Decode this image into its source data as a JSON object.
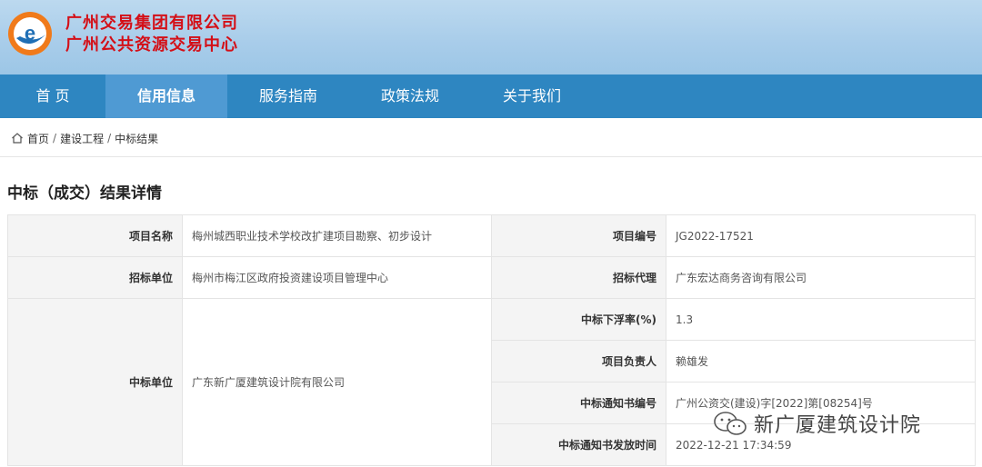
{
  "org": {
    "name_line1": "广州交易集团有限公司",
    "name_line2": "广州公共资源交易中心"
  },
  "nav": {
    "items": [
      {
        "label": "首 页"
      },
      {
        "label": "信用信息"
      },
      {
        "label": "服务指南"
      },
      {
        "label": "政策法规"
      },
      {
        "label": "关于我们"
      }
    ]
  },
  "breadcrumb": {
    "home": "首页",
    "level2": "建设工程",
    "level3": "中标结果",
    "separator": "/"
  },
  "page": {
    "title": "中标（成交）结果详情"
  },
  "detail": {
    "project_name": {
      "label": "项目名称",
      "value": "梅州城西职业技术学校改扩建项目勘察、初步设计"
    },
    "project_no": {
      "label": "项目编号",
      "value": "JG2022-17521"
    },
    "tenderer": {
      "label": "招标单位",
      "value": "梅州市梅江区政府投资建设项目管理中心"
    },
    "agent": {
      "label": "招标代理",
      "value": "广东宏达商务咨询有限公司"
    },
    "winner": {
      "label": "中标单位",
      "value": "广东新广厦建筑设计院有限公司"
    },
    "float_rate": {
      "label": "中标下浮率(%)",
      "value": "1.3"
    },
    "manager": {
      "label": "项目负责人",
      "value": "赖雄发"
    },
    "notice_no": {
      "label": "中标通知书编号",
      "value": "广州公资交(建设)字[2022]第[08254]号"
    },
    "notice_time": {
      "label": "中标通知书发放时间",
      "value": "2022-12-21 17:34:59"
    }
  },
  "watermark": {
    "text": "新广厦建筑设计院"
  },
  "colors": {
    "nav_bg": "#2e86c1",
    "nav_active": "#4f9ad3",
    "org_text": "#d40f17",
    "logo_orange": "#f07a1a",
    "logo_blue": "#1f6fb5"
  }
}
